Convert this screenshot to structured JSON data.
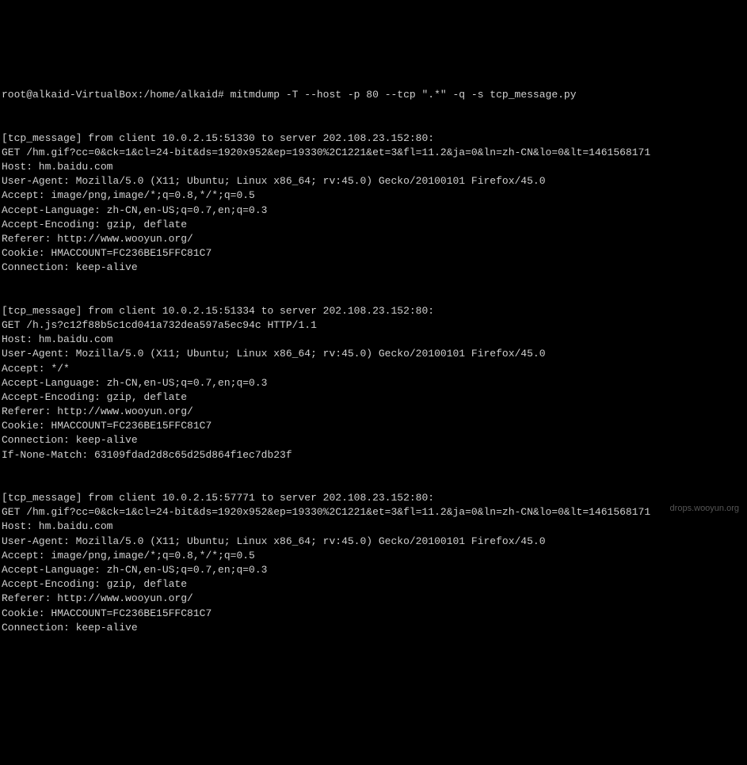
{
  "terminal": {
    "prompt": "root@alkaid-VirtualBox:/home/alkaid# ",
    "command": "mitmdump -T --host -p 80 --tcp \".*\" -q -s tcp_message.py",
    "blocks": [
      {
        "header": "[tcp_message] from client 10.0.2.15:51330 to server 202.108.23.152:80:",
        "lines": [
          "GET /hm.gif?cc=0&ck=1&cl=24-bit&ds=1920x952&ep=19330%2C1221&et=3&fl=11.2&ja=0&ln=zh-CN&lo=0&lt=1461568171",
          "Host: hm.baidu.com",
          "User-Agent: Mozilla/5.0 (X11; Ubuntu; Linux x86_64; rv:45.0) Gecko/20100101 Firefox/45.0",
          "Accept: image/png,image/*;q=0.8,*/*;q=0.5",
          "Accept-Language: zh-CN,en-US;q=0.7,en;q=0.3",
          "Accept-Encoding: gzip, deflate",
          "Referer: http://www.wooyun.org/",
          "Cookie: HMACCOUNT=FC236BE15FFC81C7",
          "Connection: keep-alive"
        ]
      },
      {
        "header": "[tcp_message] from client 10.0.2.15:51334 to server 202.108.23.152:80:",
        "lines": [
          "GET /h.js?c12f88b5c1cd041a732dea597a5ec94c HTTP/1.1",
          "Host: hm.baidu.com",
          "User-Agent: Mozilla/5.0 (X11; Ubuntu; Linux x86_64; rv:45.0) Gecko/20100101 Firefox/45.0",
          "Accept: */*",
          "Accept-Language: zh-CN,en-US;q=0.7,en;q=0.3",
          "Accept-Encoding: gzip, deflate",
          "Referer: http://www.wooyun.org/",
          "Cookie: HMACCOUNT=FC236BE15FFC81C7",
          "Connection: keep-alive",
          "If-None-Match: 63109fdad2d8c65d25d864f1ec7db23f"
        ]
      },
      {
        "header": "[tcp_message] from client 10.0.2.15:57771 to server 202.108.23.152:80:",
        "lines": [
          "GET /hm.gif?cc=0&ck=1&cl=24-bit&ds=1920x952&ep=19330%2C1221&et=3&fl=11.2&ja=0&ln=zh-CN&lo=0&lt=1461568171",
          "Host: hm.baidu.com",
          "User-Agent: Mozilla/5.0 (X11; Ubuntu; Linux x86_64; rv:45.0) Gecko/20100101 Firefox/45.0",
          "Accept: image/png,image/*;q=0.8,*/*;q=0.5",
          "Accept-Language: zh-CN,en-US;q=0.7,en;q=0.3",
          "Accept-Encoding: gzip, deflate",
          "Referer: http://www.wooyun.org/",
          "Cookie: HMACCOUNT=FC236BE15FFC81C7",
          "Connection: keep-alive"
        ]
      }
    ],
    "watermark": "drops.wooyun.org"
  }
}
